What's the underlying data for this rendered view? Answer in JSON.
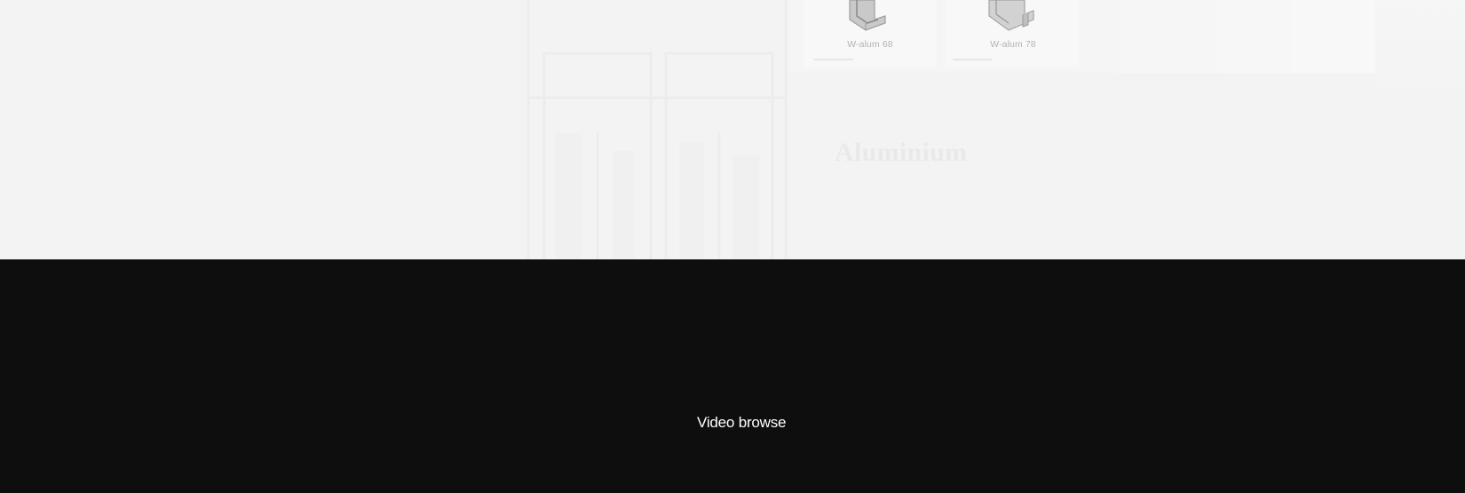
{
  "products": [
    {
      "name": "W-alum 68",
      "icon": "aluminium-profile-icon"
    },
    {
      "name": "W-alum 78",
      "icon": "aluminium-profile-icon"
    }
  ],
  "section": {
    "title": "Aluminium"
  },
  "video": {
    "label": "Video browse"
  },
  "colors": {
    "hero_bg": "#f3f3f3",
    "video_bg": "#0e0e0e",
    "video_text": "#ffffff",
    "product_text": "#b3b3b3"
  }
}
